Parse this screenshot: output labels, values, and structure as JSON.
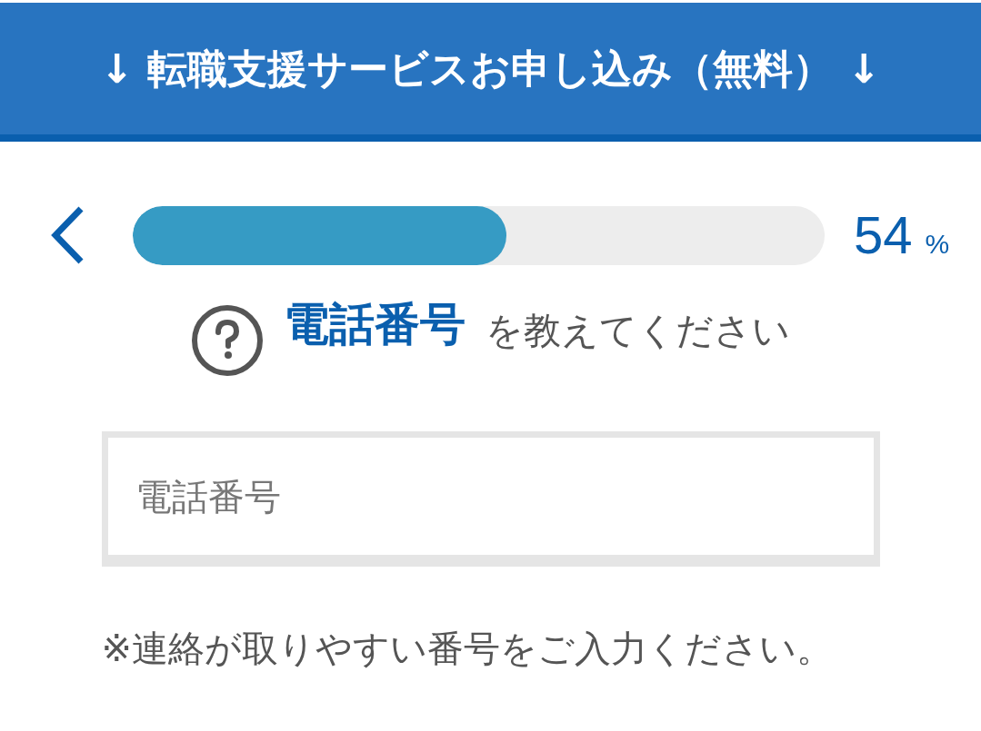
{
  "banner": {
    "text": "↓ 転職支援サービスお申し込み（無料） ↓"
  },
  "progress": {
    "level": 0.54,
    "value": "54",
    "unit": "%"
  },
  "question": {
    "field": "電話番号",
    "prompt": "を教えてください"
  },
  "phone_field": {
    "placeholder": "電話番号"
  },
  "note": "※連絡が取りやすい番号をご入力ください。"
}
